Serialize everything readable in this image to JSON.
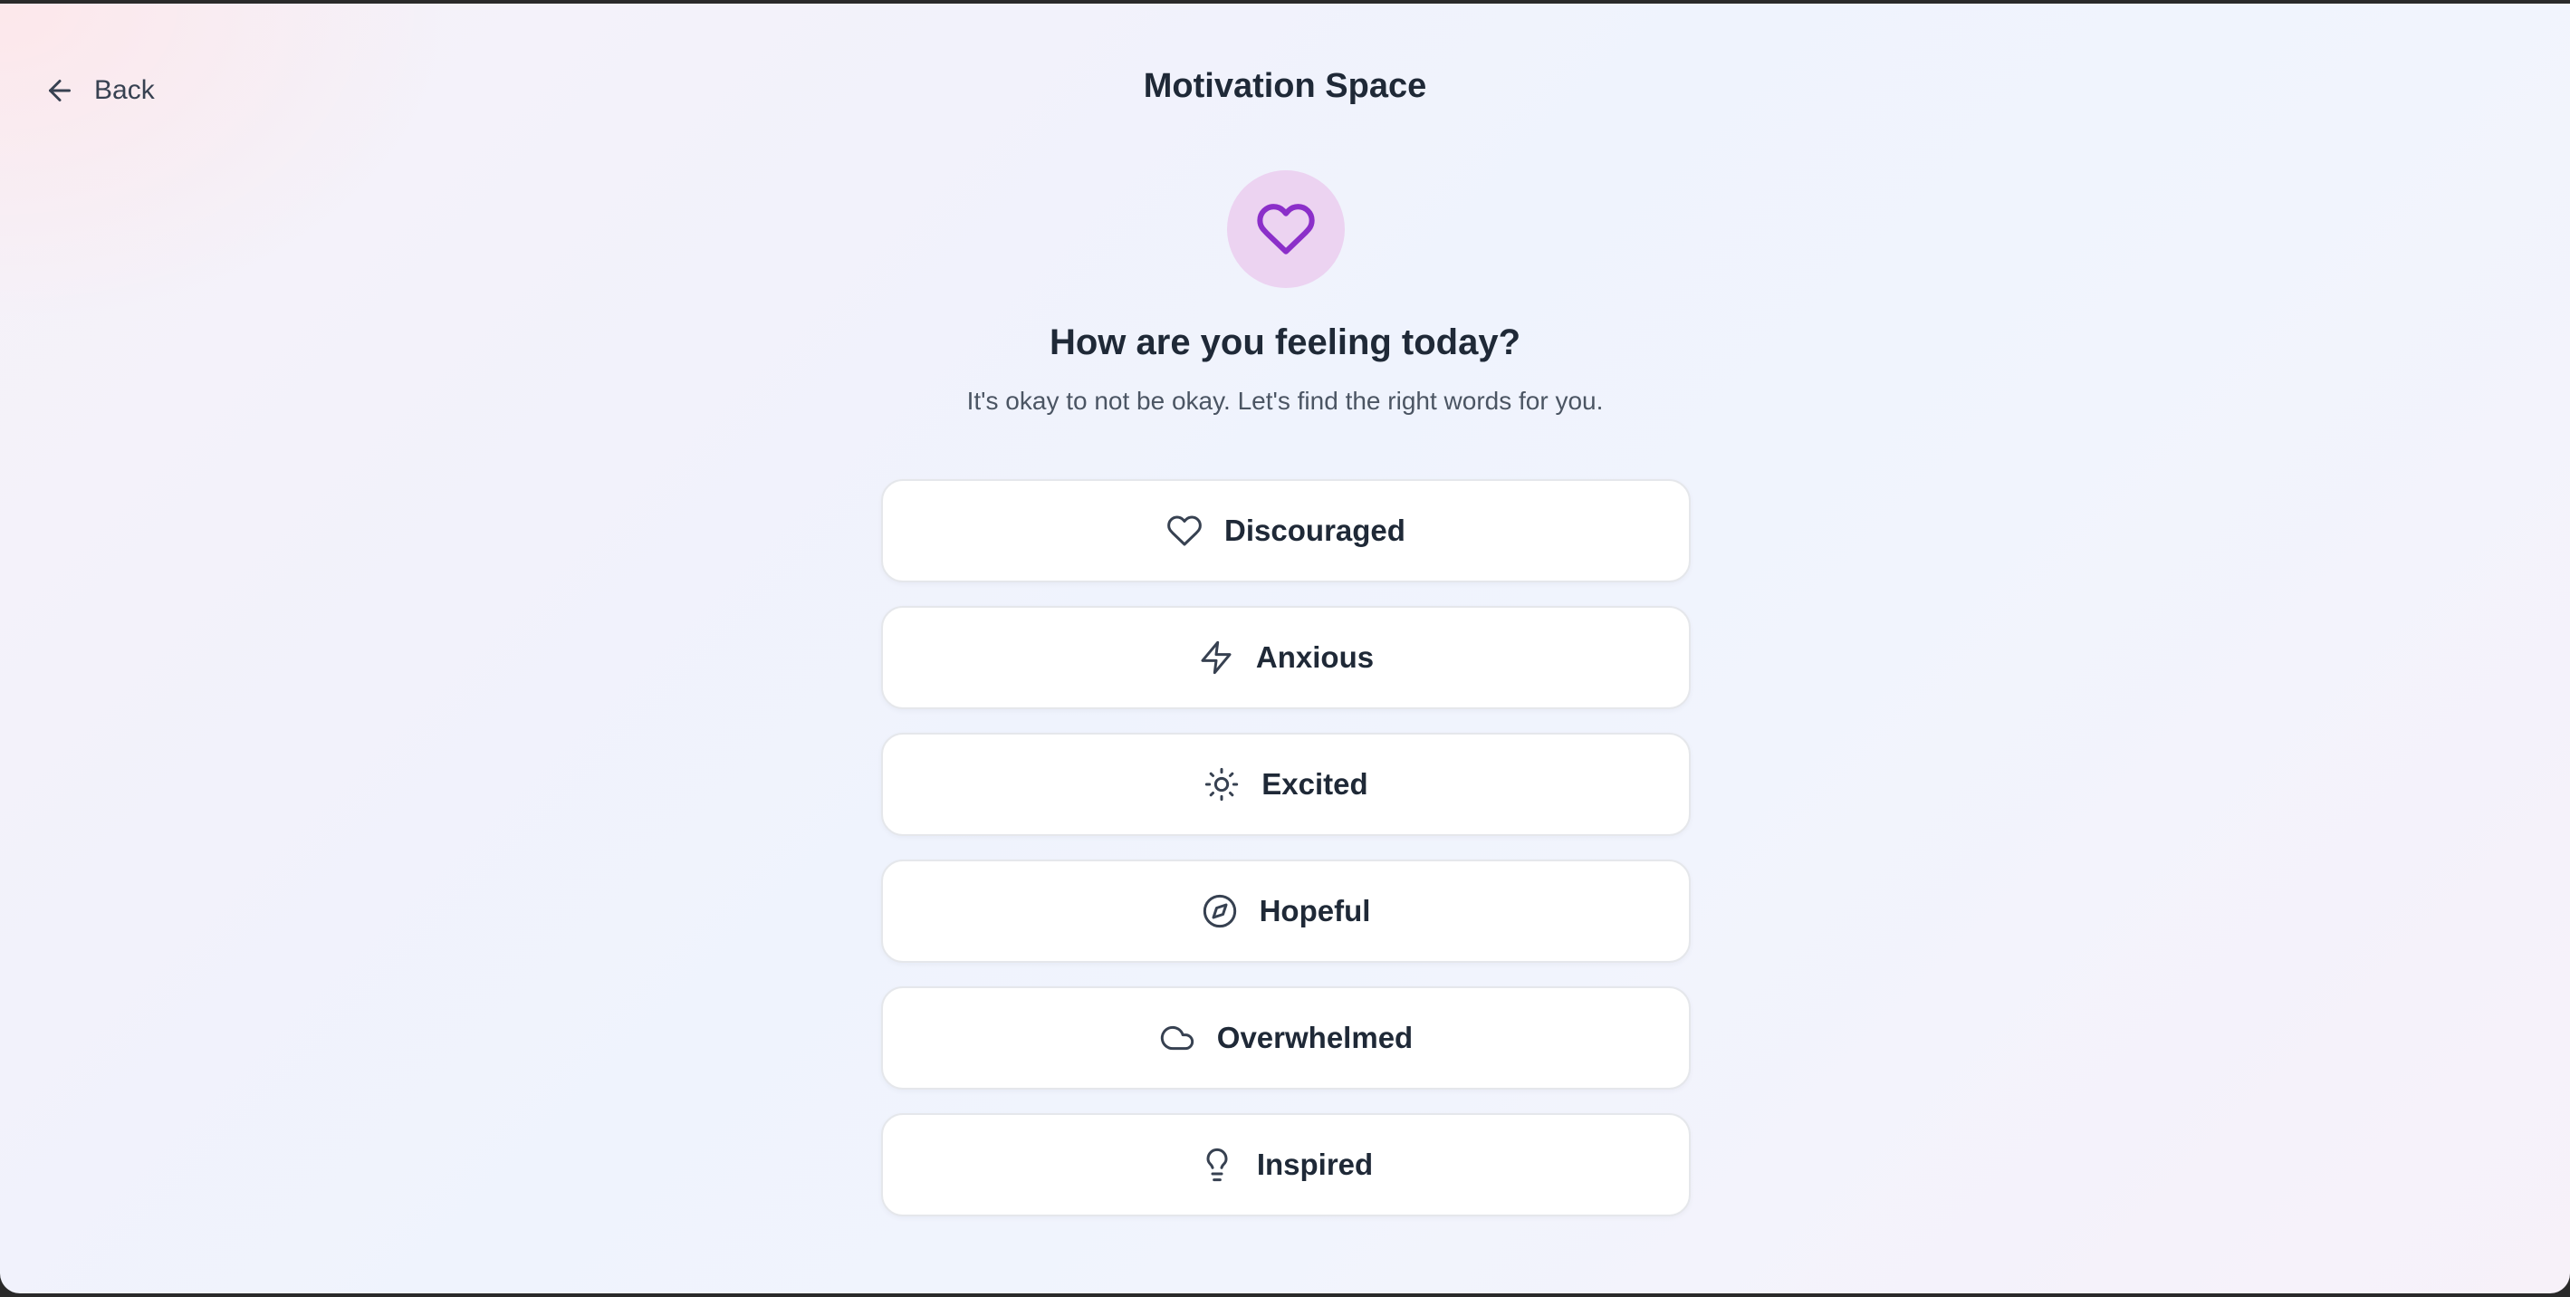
{
  "header": {
    "back_label": "Back",
    "title": "Motivation Space"
  },
  "hero": {
    "icon": "heart-icon",
    "question": "How are you feeling today?",
    "subtitle": "It's okay to not be okay. Let's find the right words for you.",
    "circle_color": "#ecd3f1",
    "icon_color": "#8b2fc9"
  },
  "moods": [
    {
      "label": "Discouraged",
      "icon": "heart-icon"
    },
    {
      "label": "Anxious",
      "icon": "lightning-icon"
    },
    {
      "label": "Excited",
      "icon": "sun-icon"
    },
    {
      "label": "Hopeful",
      "icon": "compass-icon"
    },
    {
      "label": "Overwhelmed",
      "icon": "cloud-icon"
    },
    {
      "label": "Inspired",
      "icon": "lightbulb-icon"
    }
  ]
}
